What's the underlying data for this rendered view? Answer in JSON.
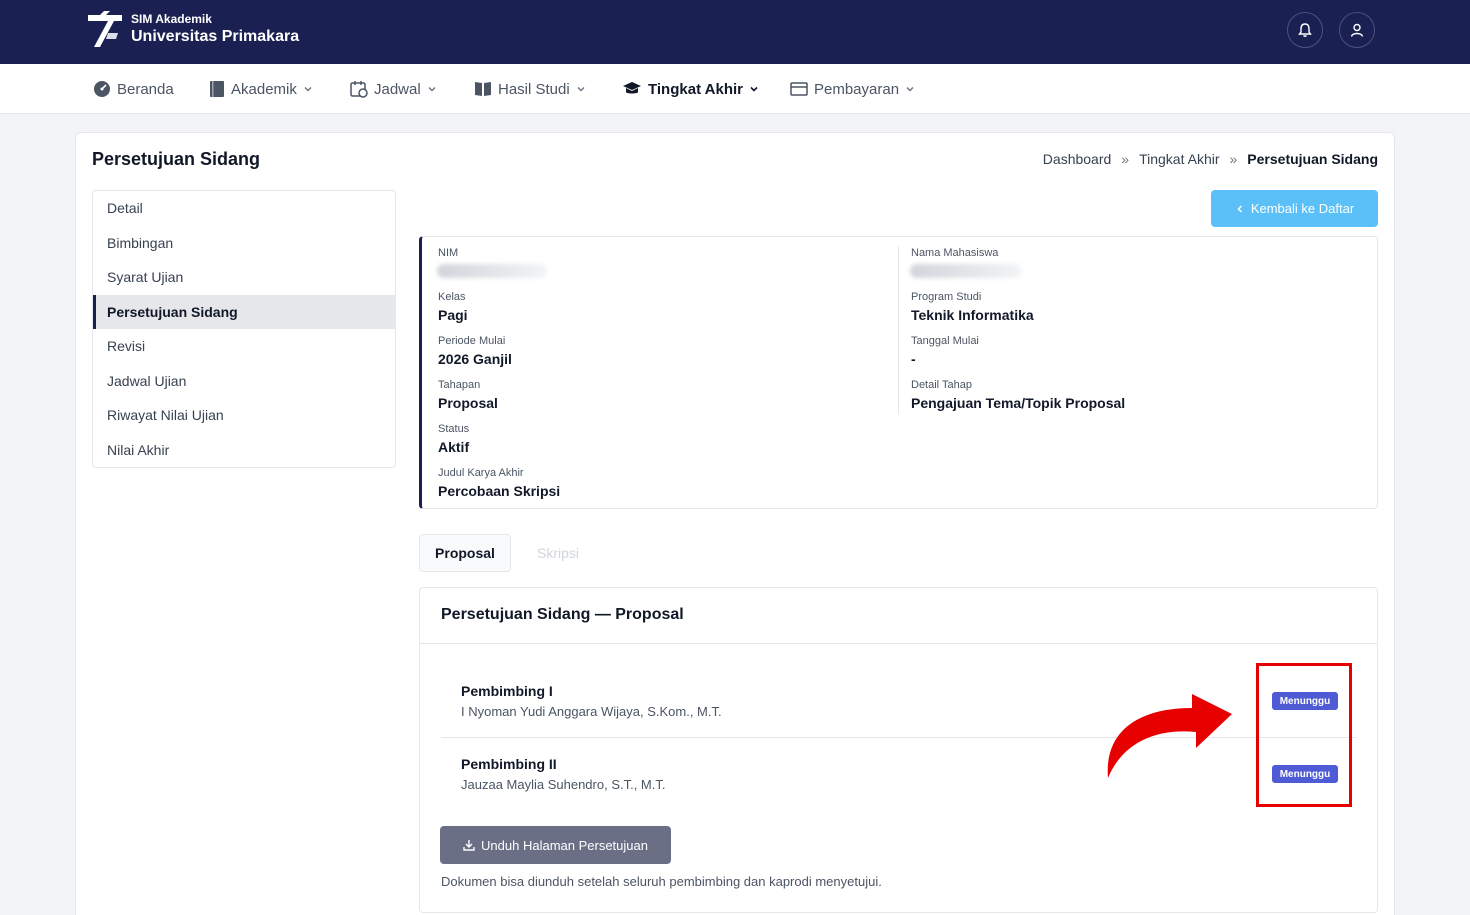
{
  "header": {
    "app_name": "SIM Akademik",
    "university": "Universitas Primakara",
    "icons": [
      "bell-icon",
      "user-icon"
    ]
  },
  "nav": {
    "items": [
      {
        "label": "Beranda",
        "icon": "gauge-icon"
      },
      {
        "label": "Akademik",
        "icon": "book-icon"
      },
      {
        "label": "Jadwal",
        "icon": "calendar-clock-icon"
      },
      {
        "label": "Hasil Studi",
        "icon": "open-book-icon"
      },
      {
        "label": "Tingkat Akhir",
        "icon": "graduation-cap-icon",
        "active": true
      },
      {
        "label": "Pembayaran",
        "icon": "payment-card-icon"
      }
    ]
  },
  "page": {
    "title": "Persetujuan Sidang",
    "breadcrumb": [
      "Dashboard",
      "Tingkat Akhir",
      "Persetujuan Sidang"
    ],
    "breadcrumb_sep": "»",
    "back_button": "Kembali ke Daftar"
  },
  "sidebar": {
    "items": [
      "Detail",
      "Bimbingan",
      "Syarat Ujian",
      "Persetujuan Sidang",
      "Revisi",
      "Jadwal Ujian",
      "Riwayat Nilai Ujian",
      "Nilai Akhir"
    ],
    "active": "Persetujuan Sidang"
  },
  "info": {
    "nim_label": "NIM",
    "nama_label": "Nama Mahasiswa",
    "kelas_label": "Kelas",
    "kelas_value": "Pagi",
    "prodi_label": "Program Studi",
    "prodi_value": "Teknik Informatika",
    "periode_label": "Periode Mulai",
    "periode_value": "2026 Ganjil",
    "tanggal_label": "Tanggal Mulai",
    "tanggal_value": "-",
    "tahapan_label": "Tahapan",
    "tahapan_value": "Proposal",
    "detail_label": "Detail Tahap",
    "detail_value": "Pengajuan Tema/Topik Proposal",
    "status_label": "Status",
    "status_value": "Aktif",
    "judul_label": "Judul Karya Akhir",
    "judul_value": "Percobaan Skripsi"
  },
  "tabs": {
    "items": [
      "Proposal",
      "Skripsi"
    ],
    "active": "Proposal"
  },
  "approval": {
    "title": "Persetujuan Sidang — Proposal",
    "rows": [
      {
        "role": "Pembimbing I",
        "name": "I Nyoman Yudi Anggara Wijaya, S.Kom., M.T.",
        "status": "Menunggu"
      },
      {
        "role": "Pembimbing II",
        "name": "Jauzaa Maylia Suhendro, S.T., M.T.",
        "status": "Menunggu"
      }
    ],
    "download_button": "Unduh Halaman Persetujuan",
    "note": "Dokumen bisa diunduh setelah seluruh pembimbing dan kaprodi menyetujui."
  },
  "colors": {
    "header_bg": "#1a2152",
    "back_button": "#5bc0f8",
    "badge": "#4f5bd5",
    "download_button": "#6b6f86",
    "annotation": "#e60000"
  }
}
